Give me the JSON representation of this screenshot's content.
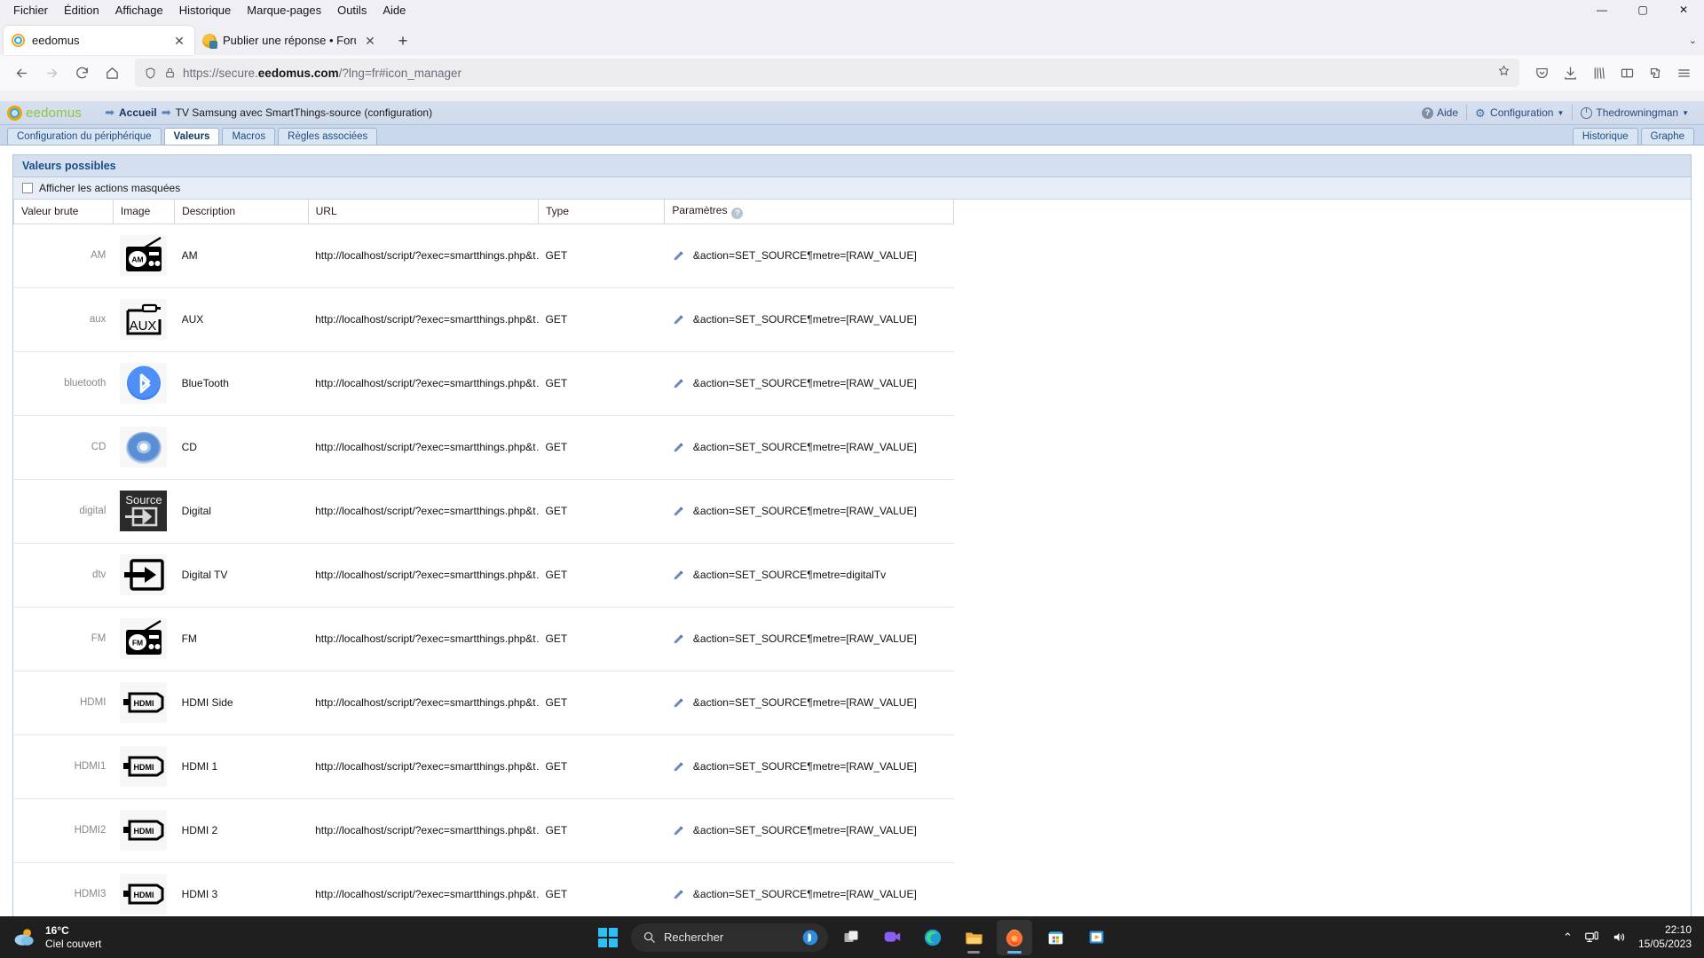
{
  "browser": {
    "menu": [
      "Fichier",
      "Édition",
      "Affichage",
      "Historique",
      "Marque-pages",
      "Outils",
      "Aide"
    ],
    "window_controls": {
      "minimize": "—",
      "maximize": "▢",
      "close": "✕"
    },
    "tabs": [
      {
        "title": "eedomus",
        "title_fade": "",
        "icon": "eedomus-favicon",
        "active": true
      },
      {
        "title": "Publier une réponse • Forum ",
        "title_fade": "ee",
        "icon": "forum-favicon",
        "active": false
      }
    ],
    "new_tab_label": "+",
    "list_all_tabs_label": "⌄",
    "nav": {
      "back": "←",
      "forward": "→",
      "reload": "⟳",
      "home": "⌂"
    },
    "url": {
      "prefix": "https://secure.",
      "domain": "eedomus.com",
      "suffix": "/?lng=fr#icon_manager"
    },
    "toolbar_icons": [
      "shield-icon",
      "lock-icon",
      "bookmark-star-icon",
      "pocket-icon",
      "downloads-icon",
      "library-icon",
      "sidebar-icon",
      "extensions-icon",
      "menu-icon"
    ]
  },
  "app": {
    "logo_text": "eedomus",
    "breadcrumb": {
      "home": "Accueil",
      "current": "TV Samsung avec SmartThings-source (configuration)",
      "separator": "➡"
    },
    "header_right": [
      {
        "label": "Aide",
        "icon": "help-icon",
        "caret": false
      },
      {
        "label": "Configuration",
        "icon": "gear-icon",
        "caret": true
      },
      {
        "label": "Thedrowningman",
        "icon": "power-icon",
        "caret": true
      }
    ],
    "tabs": [
      {
        "label": "Configuration du périphérique",
        "active": false
      },
      {
        "label": "Valeurs",
        "active": true
      },
      {
        "label": "Macros",
        "active": false
      },
      {
        "label": "Règles associées",
        "active": false
      }
    ],
    "tabs_right": [
      {
        "label": "Historique",
        "active": false
      },
      {
        "label": "Graphe",
        "active": false
      }
    ]
  },
  "panel": {
    "title": "Valeurs possibles",
    "checkbox_label": "Afficher les actions masquées",
    "checkbox_checked": false,
    "columns": [
      "Valeur brute",
      "Image",
      "Description",
      "URL",
      "Type",
      "Paramètres"
    ],
    "params_help_icon": "?",
    "rows": [
      {
        "raw": "AM",
        "icon": "am-radio-icon",
        "description": "AM",
        "url": "http://localhost/script/?exec=smartthings.php&t…",
        "type": "GET",
        "params": "&action=SET_SOURCE¶metre=[RAW_VALUE]"
      },
      {
        "raw": "aux",
        "icon": "aux-jack-icon",
        "description": "AUX",
        "url": "http://localhost/script/?exec=smartthings.php&t…",
        "type": "GET",
        "params": "&action=SET_SOURCE¶metre=[RAW_VALUE]"
      },
      {
        "raw": "bluetooth",
        "icon": "bluetooth-icon",
        "description": "BlueTooth",
        "url": "http://localhost/script/?exec=smartthings.php&t…",
        "type": "GET",
        "params": "&action=SET_SOURCE¶metre=[RAW_VALUE]"
      },
      {
        "raw": "CD",
        "icon": "cd-disc-icon",
        "description": "CD",
        "url": "http://localhost/script/?exec=smartthings.php&t…",
        "type": "GET",
        "params": "&action=SET_SOURCE¶metre=[RAW_VALUE]"
      },
      {
        "raw": "digital",
        "icon": "source-arrow-icon",
        "description": "Digital",
        "url": "http://localhost/script/?exec=smartthings.php&t…",
        "type": "GET",
        "params": "&action=SET_SOURCE¶metre=[RAW_VALUE]"
      },
      {
        "raw": "dtv",
        "icon": "input-arrow-icon",
        "description": "Digital TV",
        "url": "http://localhost/script/?exec=smartthings.php&t…",
        "type": "GET",
        "params": "&action=SET_SOURCE¶metre=digitalTv"
      },
      {
        "raw": "FM",
        "icon": "fm-radio-icon",
        "description": "FM",
        "url": "http://localhost/script/?exec=smartthings.php&t…",
        "type": "GET",
        "params": "&action=SET_SOURCE¶metre=[RAW_VALUE]"
      },
      {
        "raw": "HDMI",
        "icon": "hdmi-icon",
        "description": "HDMI Side",
        "url": "http://localhost/script/?exec=smartthings.php&t…",
        "type": "GET",
        "params": "&action=SET_SOURCE¶metre=[RAW_VALUE]"
      },
      {
        "raw": "HDMI1",
        "icon": "hdmi-icon",
        "description": "HDMI 1",
        "url": "http://localhost/script/?exec=smartthings.php&t…",
        "type": "GET",
        "params": "&action=SET_SOURCE¶metre=[RAW_VALUE]"
      },
      {
        "raw": "HDMI2",
        "icon": "hdmi-icon",
        "description": "HDMI 2",
        "url": "http://localhost/script/?exec=smartthings.php&t…",
        "type": "GET",
        "params": "&action=SET_SOURCE¶metre=[RAW_VALUE]"
      },
      {
        "raw": "HDMI3",
        "icon": "hdmi-icon",
        "description": "HDMI 3",
        "url": "http://localhost/script/?exec=smartthings.php&t…",
        "type": "GET",
        "params": "&action=SET_SOURCE¶metre=[RAW_VALUE]"
      }
    ]
  },
  "taskbar": {
    "weather": {
      "temperature": "16°C",
      "condition": "Ciel couvert",
      "icon": "cloudy-sun-icon"
    },
    "search_placeholder": "Rechercher",
    "apps": [
      "start-icon",
      "task-view-icon",
      "teams-icon",
      "edge-icon",
      "file-explorer-icon",
      "firefox-icon",
      "microsoft-store-icon",
      "media-player-icon"
    ],
    "tray": {
      "chevron": "⌃",
      "network_icon": "network-icon",
      "volume_icon": "volume-icon",
      "time": "22:10",
      "date": "15/05/2023"
    }
  },
  "colors": {
    "accent_blue": "#1a4b87",
    "header_bg": "#d6e0ef",
    "bluetooth": "#3b82f6",
    "taskbar_bg": "#1f1f1f"
  }
}
